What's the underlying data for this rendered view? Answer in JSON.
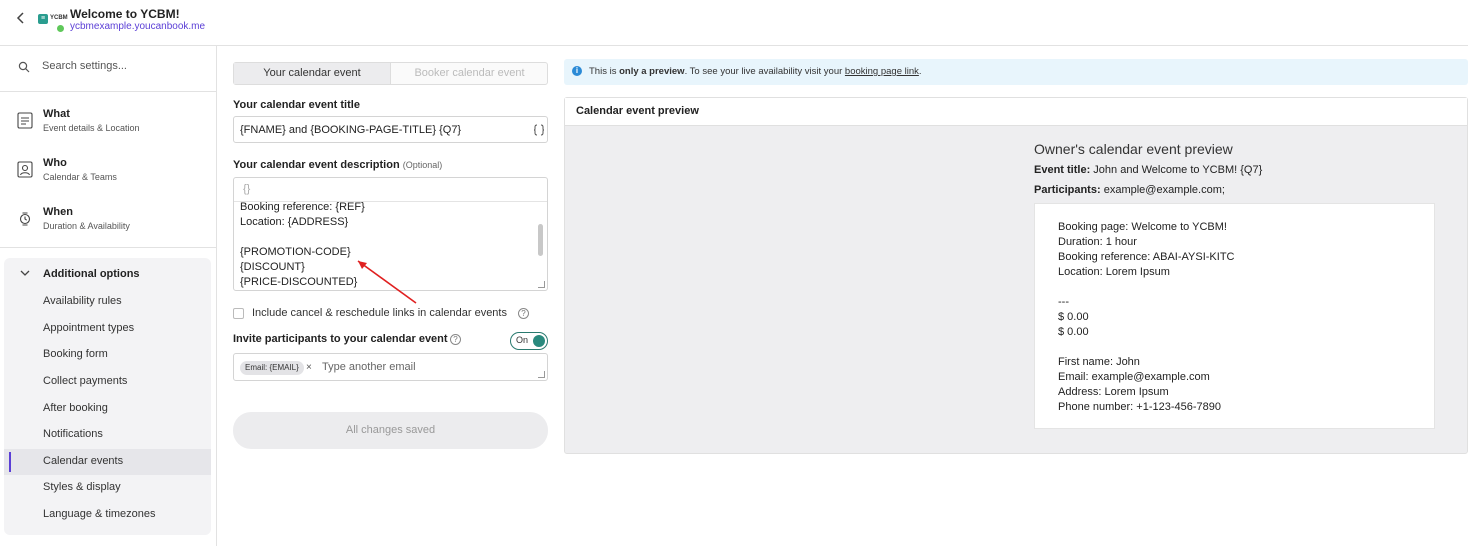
{
  "header": {
    "title": "Welcome to YCBM!",
    "url": "ycbmexample.youcanbook.me",
    "logo_text": "YCBM"
  },
  "sidebar": {
    "search_placeholder": "Search settings...",
    "main_items": [
      {
        "title": "What",
        "subtitle": "Event details & Location"
      },
      {
        "title": "Who",
        "subtitle": "Calendar & Teams"
      },
      {
        "title": "When",
        "subtitle": "Duration & Availability"
      }
    ],
    "additional_title": "Additional options",
    "sub_items": [
      "Availability rules",
      "Appointment types",
      "Booking form",
      "Collect payments",
      "After booking",
      "Notifications",
      "Calendar events",
      "Styles & display",
      "Language & timezones"
    ],
    "active_sub_item": "Calendar events"
  },
  "form": {
    "tabs": [
      "Your calendar event",
      "Booker calendar event"
    ],
    "title_label": "Your calendar event title",
    "title_value": "{FNAME} and {BOOKING-PAGE-TITLE} {Q7}",
    "desc_label": "Your calendar event description",
    "desc_optional": "(Optional)",
    "desc_variable_icon": "{}",
    "desc_lines": [
      "Booking reference: {REF}",
      "Location: {ADDRESS}",
      "",
      "{PROMOTION-CODE}",
      "{DISCOUNT}",
      "{PRICE-DISCOUNTED}"
    ],
    "cancel_links_label": "Include cancel & reschedule links in calendar events",
    "invite_label": "Invite participants to your calendar event",
    "toggle_label": "On",
    "invite_chip": "Email: {EMAIL}",
    "invite_placeholder": "Type another email",
    "save_label": "All changes saved"
  },
  "info": {
    "prefix": "This is",
    "bold": "only a preview",
    "middle": ". To see your live availability visit your",
    "link": "booking page link",
    "suffix": "."
  },
  "preview": {
    "header": "Calendar event preview",
    "owner_title": "Owner's calendar event preview",
    "event_title_label": "Event title:",
    "event_title_value": "John and Welcome to YCBM! {Q7}",
    "participants_label": "Participants:",
    "participants_value": "example@example.com;",
    "card_lines": [
      "Booking page: Welcome to YCBM!",
      "Duration: 1 hour",
      "Booking reference: ABAI-AYSI-KITC",
      "Location: Lorem Ipsum",
      "",
      "---",
      "$ 0.00",
      "$ 0.00",
      "",
      "First name: John",
      "Email: example@example.com",
      "Address: Lorem Ipsum",
      "Phone number: +1-123-456-7890"
    ]
  },
  "colors": {
    "accent": "#5b3fd6",
    "toggle": "#2a8a7e",
    "info_bg": "#e8f5fc",
    "arrow": "#e02020"
  },
  "icons": [
    "back-arrow-icon",
    "search-icon",
    "what-icon",
    "who-icon",
    "when-icon",
    "chevron-down-icon",
    "variables-icon",
    "help-icon",
    "info-icon",
    "remove-chip-icon"
  ]
}
